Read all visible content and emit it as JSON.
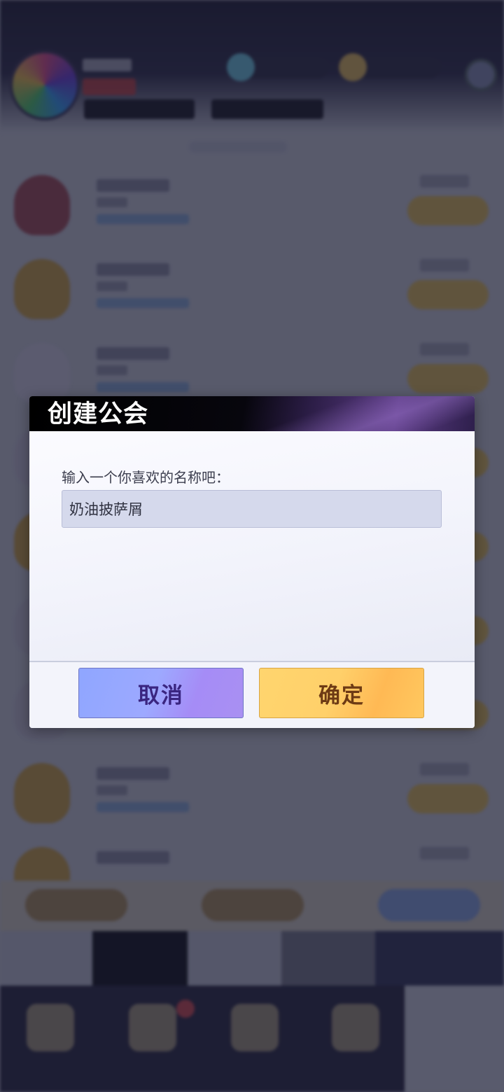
{
  "dialog": {
    "title": "创建公会",
    "prompt": "输入一个你喜欢的名称吧：",
    "name_input": {
      "value": "奶油披萨屑"
    },
    "cancel_label": "取消",
    "confirm_label": "确定"
  },
  "colors": {
    "cancel_button": "#9aa5ff",
    "confirm_button": "#ffd26a",
    "overlay": "#1a1c30"
  }
}
